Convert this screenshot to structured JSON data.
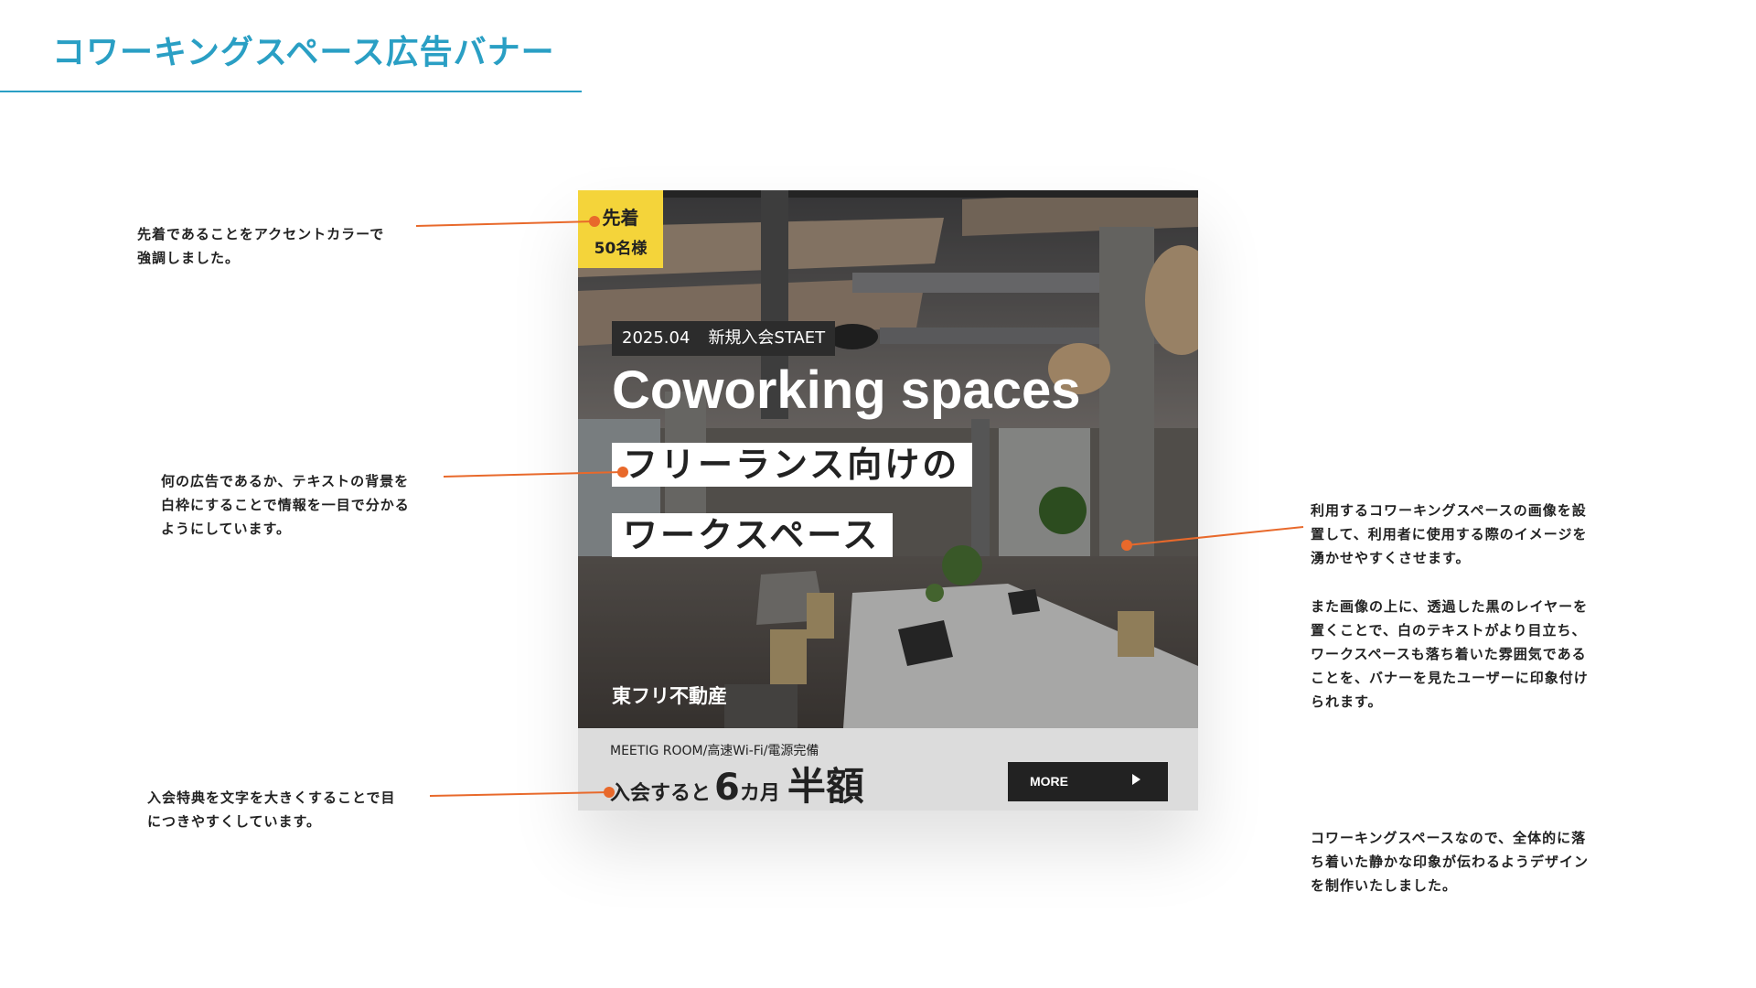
{
  "page": {
    "title": "コワーキングスペース広告バナー",
    "accent_color": "#2a9fc4",
    "pointer_color": "#e8692b"
  },
  "notes": {
    "badge": "先着であることをアクセントカラーで\n強調しました。",
    "tagline": "何の広告であるか、テキストの背景を\n白枠にすることで情報を一目で分かる\nようにしています。",
    "offer": "入会特典を文字を大きくすることで目\nにつきやすくしています。",
    "photo_1": "利用するコワーキングスペースの画像を設\n置して、利用者に使用する際のイメージを\n湧かせやすくさせます。",
    "photo_2": "また画像の上に、透過した黒のレイヤーを\n置くことで、白のテキストがより目立ち、\nワークスペースも落ち着いた雰囲気である\nことを、バナーを見たユーザーに印象付け\nられます。",
    "overall": "コワーキングスペースなので、全体的に落\nち着いた静かな印象が伝わるようデザイン\nを制作いたしました。"
  },
  "banner": {
    "badge": {
      "line1": "先着",
      "line2": "50名様",
      "color": "#f4d43a"
    },
    "date_tag": {
      "date": "2025.04",
      "text": "新規入会STAET"
    },
    "headline": "Coworking spaces",
    "tagline_1": "フリーランス向けの",
    "tagline_2": "ワークスペース",
    "company": "東フリ不動産",
    "features": "MEETIG ROOM/高速Wi-Fi/電源完備",
    "offer": {
      "pre": "入会すると",
      "num": "6",
      "unit": "カ月",
      "big": "半額"
    },
    "more_label": "MORE"
  }
}
